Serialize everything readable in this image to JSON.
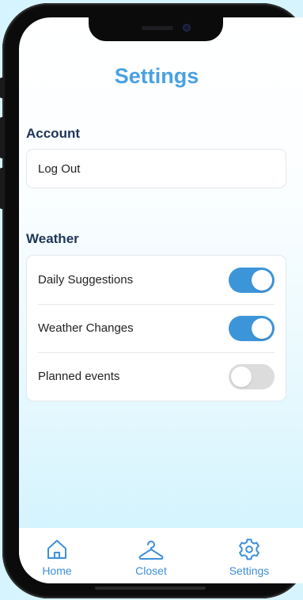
{
  "header": {
    "title": "Settings"
  },
  "account": {
    "title": "Account",
    "items": [
      {
        "label": "Log Out"
      }
    ]
  },
  "weather": {
    "title": "Weather",
    "items": [
      {
        "label": "Daily Suggestions",
        "enabled": true
      },
      {
        "label": "Weather Changes",
        "enabled": true
      },
      {
        "label": "Planned events",
        "enabled": false
      }
    ]
  },
  "tabbar": {
    "items": [
      {
        "label": "Home",
        "icon": "home-icon"
      },
      {
        "label": "Closet",
        "icon": "hanger-icon"
      },
      {
        "label": "Settings",
        "icon": "gear-icon"
      }
    ]
  },
  "colors": {
    "accent": "#3d95d9",
    "title": "#4aa1e0",
    "section_header": "#1d3557",
    "toggle_off": "#dcdcdc"
  }
}
